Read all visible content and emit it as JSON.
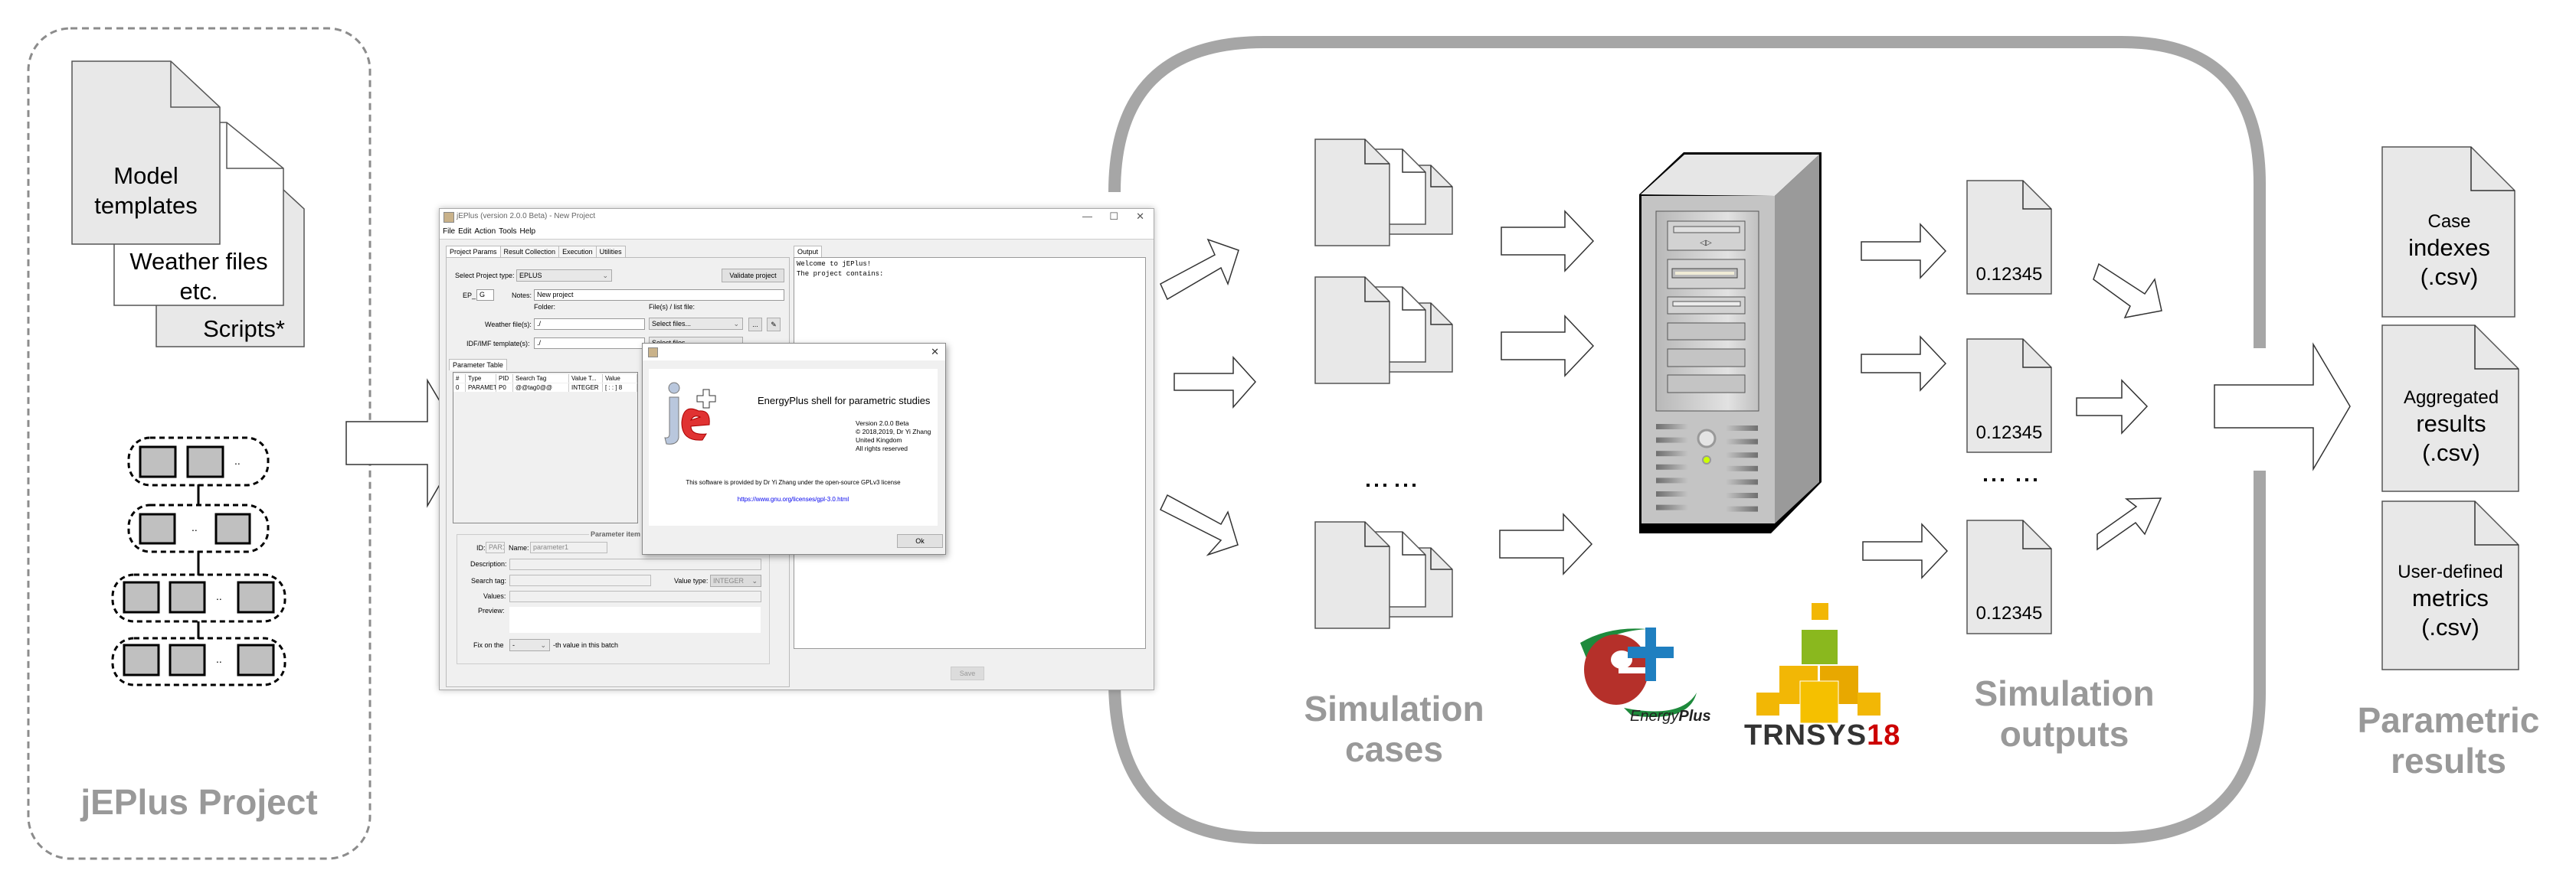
{
  "inputs": {
    "documents": [
      {
        "label_lines": [
          "Model",
          "templates"
        ]
      },
      {
        "label_lines": [
          "Weather files",
          "etc."
        ]
      },
      {
        "label_lines": [
          "Scripts*"
        ]
      }
    ],
    "parameter_tree": {
      "levels": [
        {
          "boxes": 2,
          "ellipsis": ".."
        },
        {
          "boxes": 2,
          "ellipsis": ".."
        },
        {
          "boxes": 3,
          "ellipsis": ".."
        },
        {
          "boxes": 3,
          "ellipsis": ".."
        }
      ]
    },
    "section_label": "jEPlus Project"
  },
  "app_window": {
    "title": "jEPlus (version 2.0.0 Beta) - New Project",
    "window_controls": {
      "minimize": "—",
      "maximize": "☐",
      "close": "✕"
    },
    "menu": [
      "File",
      "Edit",
      "Action",
      "Tools",
      "Help"
    ],
    "tabs": [
      "Project Params",
      "Result Collection",
      "Execution",
      "Utilities"
    ],
    "active_tab": "Project Params",
    "project_type_label": "Select Project type:",
    "project_type_value": "EPLUS",
    "validate_button": "Validate project",
    "prefix_label": "EP_",
    "prefix_value": "G",
    "notes_label": "Notes:",
    "notes_value": "New project",
    "folder_header": "Folder:",
    "files_header": "File(s) / list file:",
    "weather_label": "Weather file(s):",
    "weather_folder": "./",
    "weather_files": "Select files...",
    "idf_label": "IDF/IMF template(s):",
    "idf_folder": "./",
    "idf_files": "Select files...",
    "browse_button": "...",
    "param_table_tab": "Parameter Table",
    "param_table": {
      "columns": [
        "#",
        "Type",
        "PID",
        "Search Tag",
        "Value T...",
        "Value"
      ],
      "rows": [
        [
          "0",
          "PARAMET...",
          "P0",
          "@@tag0@@",
          "INTEGER",
          "[ : : ] 8"
        ]
      ]
    },
    "param_item": {
      "legend": "Parameter item",
      "id_label": "ID:",
      "id_value": "PAR1",
      "name_label": "Name:",
      "name_value": "parameter1",
      "description_label": "Description:",
      "search_tag_label": "Search tag:",
      "value_type_label": "Value type:",
      "value_type_value": "INTEGER",
      "values_label": "Values:",
      "preview_label": "Preview:",
      "fix_label": "Fix on the",
      "fix_value": "-",
      "fix_suffix": "-th value in this batch"
    },
    "output_tab": "Output",
    "output_lines": [
      "Welcome to jEPlus!",
      "The project contains:"
    ],
    "save_button": "Save"
  },
  "about_dialog": {
    "close": "✕",
    "logo_text": "je",
    "heading": "EnergyPlus shell for parametric studies",
    "version_lines": [
      "Version 2.0.0 Beta",
      "© 2018,2019, Dr Yi Zhang",
      "United Kingdom",
      "All rights reserved"
    ],
    "license_text": "This software is provided by Dr Yi Zhang under the open-source GPLv3 license",
    "license_link": "https://www.gnu.org/licenses/gpl-3.0.html",
    "ok_button": "Ok"
  },
  "simulation": {
    "cases_label_lines": [
      "Simulation",
      "cases"
    ],
    "ellipsis": "... ...",
    "engines": [
      {
        "name": "EnergyPlus",
        "wordmark_light": "Energy",
        "wordmark_bold": "Plus"
      },
      {
        "name": "TRNSYS18",
        "wordmark_dark": "TRNSYS",
        "wordmark_red": "18"
      }
    ],
    "outputs_label_lines": [
      "Simulation",
      "outputs"
    ],
    "output_values": [
      "0.12345",
      "0.12345",
      "0.12345"
    ]
  },
  "results": {
    "documents": [
      {
        "small": "Case",
        "large": "indexes",
        "ext": "(.csv)"
      },
      {
        "small": "Aggregated",
        "large": "results",
        "ext": "(.csv)"
      },
      {
        "small": "User-defined",
        "large": "metrics",
        "ext": "(.csv)"
      }
    ],
    "section_label_lines": [
      "Parametric",
      "results"
    ]
  },
  "colors": {
    "label_gray": "#999999",
    "frame_gray": "#a6a6a6",
    "doc_fill": "#e8e8e8",
    "param_box_fill": "#c0c0c0",
    "ep_red": "#b5302a",
    "ep_blue": "#1f7fc0",
    "ep_green": "#1e8a3c",
    "trnsys_yellow": "#f2b705",
    "trnsys_green": "#8ab81e",
    "trnsys_red": "#cc0000",
    "link_blue": "#0000ee"
  }
}
